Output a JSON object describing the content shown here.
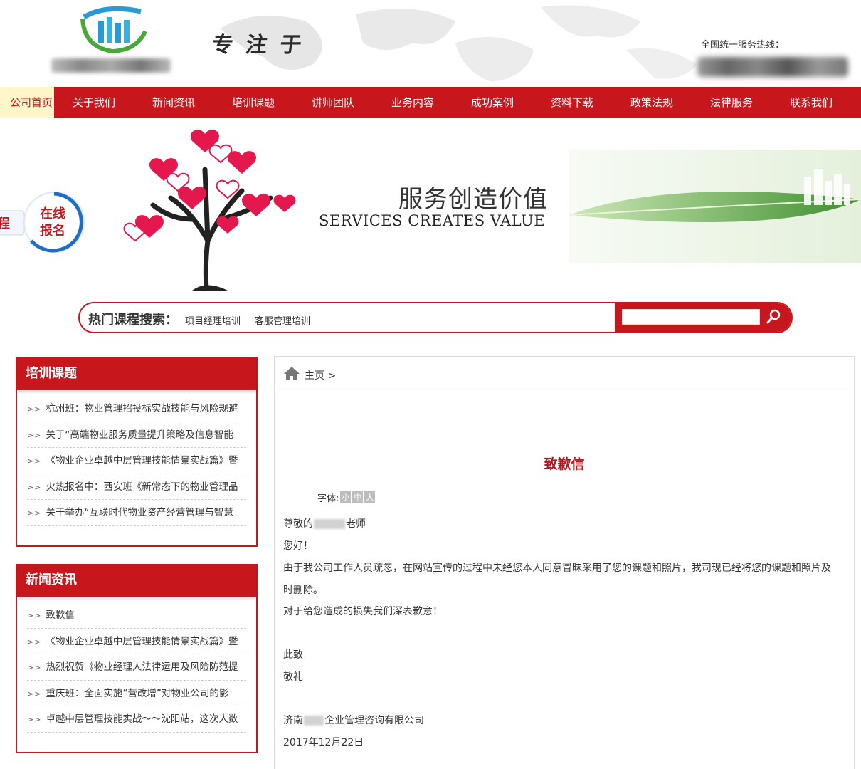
{
  "header": {
    "slogan": "专注于",
    "hotline_label": "全国统一服务热线："
  },
  "nav": {
    "items": [
      "公司首页",
      "关于我们",
      "新闻资讯",
      "培训课题",
      "讲师团队",
      "业务内容",
      "成功案例",
      "资料下载",
      "政策法规",
      "法律服务",
      "联系我们"
    ]
  },
  "banner": {
    "signup_prefix": "程",
    "signup_line1": "在线",
    "signup_line2": "报名",
    "title_cn": "服务创造价值",
    "title_en": "SERVICES CREATES VALUE"
  },
  "search": {
    "label": "热门课程搜索：",
    "tags": [
      "项目经理培训",
      "客服管理培训"
    ],
    "input_value": ""
  },
  "sidebar": {
    "training": {
      "title": "培训课题",
      "items": [
        "杭州班：物业管理招投标实战技能与风险规避",
        "关于“高端物业服务质量提升策略及信息智能",
        "《物业企业卓越中层管理技能情景实战篇》暨",
        "火热报名中：西安班《新常态下的物业管理品",
        "关于举办“互联时代物业资产经营管理与智慧"
      ]
    },
    "news": {
      "title": "新闻资讯",
      "items": [
        "致歉信",
        "《物业企业卓越中层管理技能情景实战篇》暨",
        "热烈祝贺《物业经理人法律运用及风险防范提",
        "重庆班：全面实施“营改增”对物业公司的影",
        "卓越中层管理技能实战～～沈阳站，这次人数"
      ]
    }
  },
  "main": {
    "breadcrumb": "主页 >",
    "title": "致歉信",
    "font_label": "字体:",
    "font_sizes": [
      "小",
      "中",
      "大"
    ],
    "greeting_pre": "尊敬的",
    "greeting_post": "老师",
    "hello": "您好！",
    "para1": "由于我公司工作人员疏忽，在网站宣传的过程中未经您本人同意冒昧采用了您的课题和照片，我司现已经将您的课题和照片及",
    "para1_cont": "时删除。",
    "para2": "对于给您造成的损失我们深表歉意！",
    "closing1": "此致",
    "closing2": "敬礼",
    "company_pre": "济南",
    "company_post": "企业管理咨询有限公司",
    "date": "2017年12月22日"
  }
}
